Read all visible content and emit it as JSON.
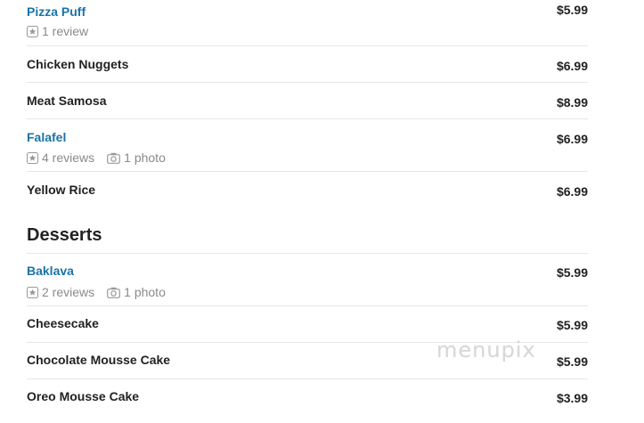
{
  "sections": [
    {
      "items": [
        {
          "name": "Pizza Puff",
          "price": "$5.99",
          "reviews": "1 review"
        },
        {
          "name": "Chicken Nuggets",
          "price": "$6.99"
        },
        {
          "name": "Meat Samosa",
          "price": "$8.99"
        },
        {
          "name": "Falafel",
          "price": "$6.99",
          "reviews": "4 reviews",
          "photos": "1 photo"
        },
        {
          "name": "Yellow Rice",
          "price": "$6.99"
        }
      ]
    },
    {
      "title": "Desserts",
      "items": [
        {
          "name": "Baklava",
          "price": "$5.99",
          "reviews": "2 reviews",
          "photos": "1 photo"
        },
        {
          "name": "Cheesecake",
          "price": "$5.99"
        },
        {
          "name": "Chocolate Mousse Cake",
          "price": "$5.99"
        },
        {
          "name": "Oreo Mousse Cake",
          "price": "$3.99"
        }
      ]
    }
  ],
  "watermark": "menupix",
  "colors": {
    "link": "#1a73a7",
    "text": "#222222",
    "muted": "#8a8a8a",
    "divider": "#e6e6e6"
  }
}
